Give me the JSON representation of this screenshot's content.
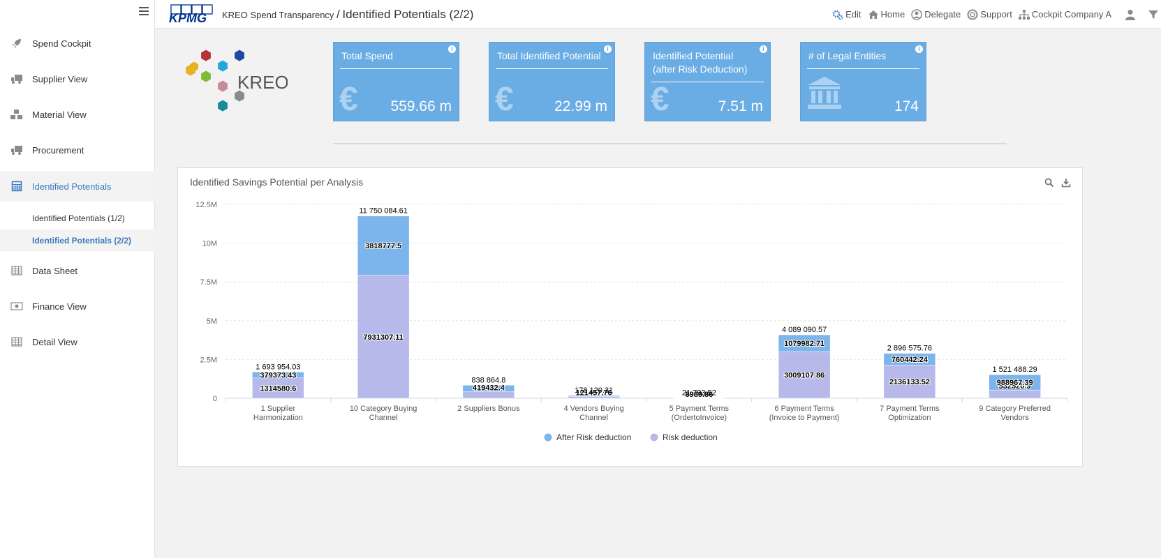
{
  "sidebar": {
    "items": [
      {
        "label": "Spend Cockpit",
        "icon": "rocket-icon"
      },
      {
        "label": "Supplier View",
        "icon": "truck-icon"
      },
      {
        "label": "Material View",
        "icon": "cubes-icon"
      },
      {
        "label": "Procurement",
        "icon": "truck-icon"
      },
      {
        "label": "Identified Potentials",
        "icon": "calculator-icon"
      },
      {
        "label": "Data Sheet",
        "icon": "table-icon"
      },
      {
        "label": "Finance View",
        "icon": "money-icon"
      },
      {
        "label": "Detail View",
        "icon": "table-icon"
      }
    ],
    "subitems": [
      {
        "label": "Identified Potentials (1/2)"
      },
      {
        "label": "Identified Potentials (2/2)"
      }
    ]
  },
  "header": {
    "logo": "KPMG",
    "app_name": "KREO Spend Transparency",
    "separator": "/",
    "page_title": "Identified Potentials (2/2)",
    "links": [
      {
        "label": "Edit",
        "icon": "gears-icon"
      },
      {
        "label": "Home",
        "icon": "home-icon"
      },
      {
        "label": "Delegate",
        "icon": "user-circle-icon"
      },
      {
        "label": "Support",
        "icon": "lifebuoy-icon"
      },
      {
        "label": "Cockpit Company A",
        "icon": "sitemap-icon"
      }
    ]
  },
  "brand": {
    "logo_text": "KREO"
  },
  "kpis": [
    {
      "title": "Total Spend",
      "value": "559.66 m",
      "icon": "euro-icon"
    },
    {
      "title": "Total Identified Potential",
      "value": "22.99 m",
      "icon": "euro-icon"
    },
    {
      "title": "Identified Potential (after Risk Deduction)",
      "value": "7.51 m",
      "icon": "euro-icon"
    },
    {
      "title": "# of Legal Entities",
      "value": "174",
      "icon": "bank-icon"
    }
  ],
  "colors": {
    "kpi": "#6aace4",
    "after_risk": "#7cb5ec",
    "risk": "#b7b9ea"
  },
  "chart_data": {
    "type": "bar",
    "stacked": true,
    "title": "Identified Savings Potential per Analysis",
    "categories": [
      "1 Supplier Harmonization",
      "10 Category Buying Channel",
      "2 Suppliers Bonus",
      "4 Vendors Buying Channel",
      "5 Payment Terms (OrdertoInvoice)",
      "6 Payment Terms (Invoice to Payment)",
      "7 Payment Terms Optimization",
      "9 Category Preferred Vendors"
    ],
    "series": [
      {
        "name": "After Risk deduction",
        "color": "#7cb5ec",
        "values": [
          379373.43,
          3818777.5,
          419432.4,
          56662.55,
          12804.66,
          1079982.71,
          760442.24,
          988967.39
        ],
        "labels": [
          "379373.43",
          "3818777.5",
          "",
          "",
          "",
          "1079982.71",
          "760442.24",
          "988967.39"
        ]
      },
      {
        "name": "Risk deduction",
        "color": "#b7b9ea",
        "values": [
          1314580.6,
          7931307.11,
          419432.4,
          121457.76,
          8989.86,
          3009107.86,
          2136133.52,
          532520.9
        ],
        "labels": [
          "1314580.6",
          "7931307.11",
          "419432.4",
          "121457.76",
          "8989.86",
          "3009107.86",
          "2136133.52",
          "532520.9"
        ]
      }
    ],
    "totals": [
      "1 693 954.03",
      "11 750 084.61",
      "838 864.8",
      "178 120.31",
      "21 793.52",
      "4 089 090.57",
      "2 896 575.76",
      "1 521 488.29"
    ],
    "y_ticks": [
      "0",
      "2.5M",
      "5M",
      "7.5M",
      "10M",
      "12.5M"
    ],
    "ylim": [
      0,
      12500000
    ],
    "grid": true,
    "legend_position": "bottom-center"
  }
}
